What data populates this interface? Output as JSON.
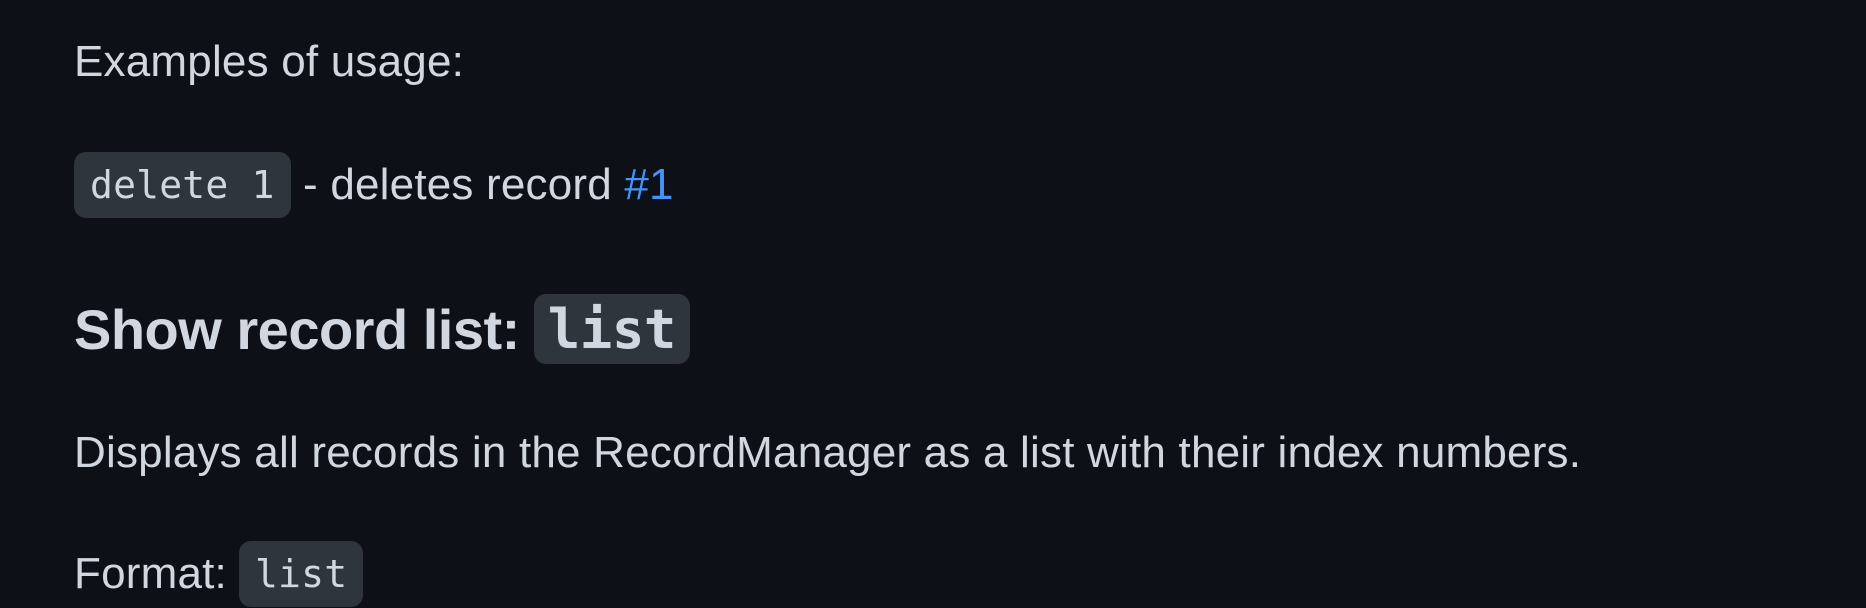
{
  "examples_heading": "Examples of usage:",
  "example_delete": {
    "code": "delete 1",
    "separator": " - deletes record ",
    "link": "#1"
  },
  "list_section": {
    "heading": "Show record list:",
    "heading_code": "list",
    "description": "Displays all records in the RecordManager as a list with their index numbers.",
    "format_label": "Format:",
    "format_code": "list"
  },
  "colors": {
    "background": "#0d1117",
    "text": "#d1d7e0",
    "code_background": "#2f353d",
    "link": "#4493f8"
  }
}
